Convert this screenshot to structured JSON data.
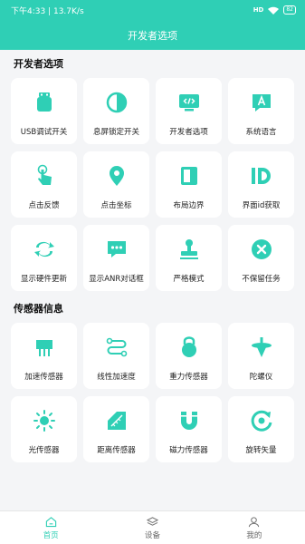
{
  "status_bar": {
    "time_speed": "下午4:33 | 13.7K/s",
    "signal": "HD",
    "battery": "82"
  },
  "header": {
    "title": "开发者选项"
  },
  "sections": [
    {
      "title": "开发者选项",
      "items": [
        {
          "label": "USB调试开关",
          "icon": "usb-icon"
        },
        {
          "label": "息屏锁定开关",
          "icon": "contrast-icon"
        },
        {
          "label": "开发者选项",
          "icon": "code-monitor-icon"
        },
        {
          "label": "系统语言",
          "icon": "language-icon"
        },
        {
          "label": "点击反馈",
          "icon": "tap-icon"
        },
        {
          "label": "点击坐标",
          "icon": "location-pin-icon"
        },
        {
          "label": "布局边界",
          "icon": "layout-bounds-icon"
        },
        {
          "label": "界面id获取",
          "icon": "id-icon"
        },
        {
          "label": "显示硬件更新",
          "icon": "refresh-icon"
        },
        {
          "label": "显示ANR对话框",
          "icon": "dialog-icon"
        },
        {
          "label": "严格模式",
          "icon": "stamp-icon"
        },
        {
          "label": "不保留任务",
          "icon": "close-circle-icon"
        }
      ]
    },
    {
      "title": "传感器信息",
      "items": [
        {
          "label": "加速传感器",
          "icon": "chip-icon"
        },
        {
          "label": "线性加速度",
          "icon": "path-icon"
        },
        {
          "label": "重力传感器",
          "icon": "kettlebell-icon"
        },
        {
          "label": "陀螺仪",
          "icon": "gyroscope-icon"
        },
        {
          "label": "光传感器",
          "icon": "sun-icon"
        },
        {
          "label": "距离传感器",
          "icon": "ruler-icon"
        },
        {
          "label": "磁力传感器",
          "icon": "magnet-icon"
        },
        {
          "label": "旋转矢量",
          "icon": "rotate-icon"
        }
      ]
    }
  ],
  "bottom_nav": [
    {
      "label": "首页",
      "icon": "home-icon",
      "active": true
    },
    {
      "label": "设备",
      "icon": "layers-icon",
      "active": false
    },
    {
      "label": "我的",
      "icon": "user-icon",
      "active": false
    }
  ],
  "colors": {
    "accent": "#2fcfb5",
    "background": "#f4f5f7",
    "tile": "#ffffff"
  }
}
